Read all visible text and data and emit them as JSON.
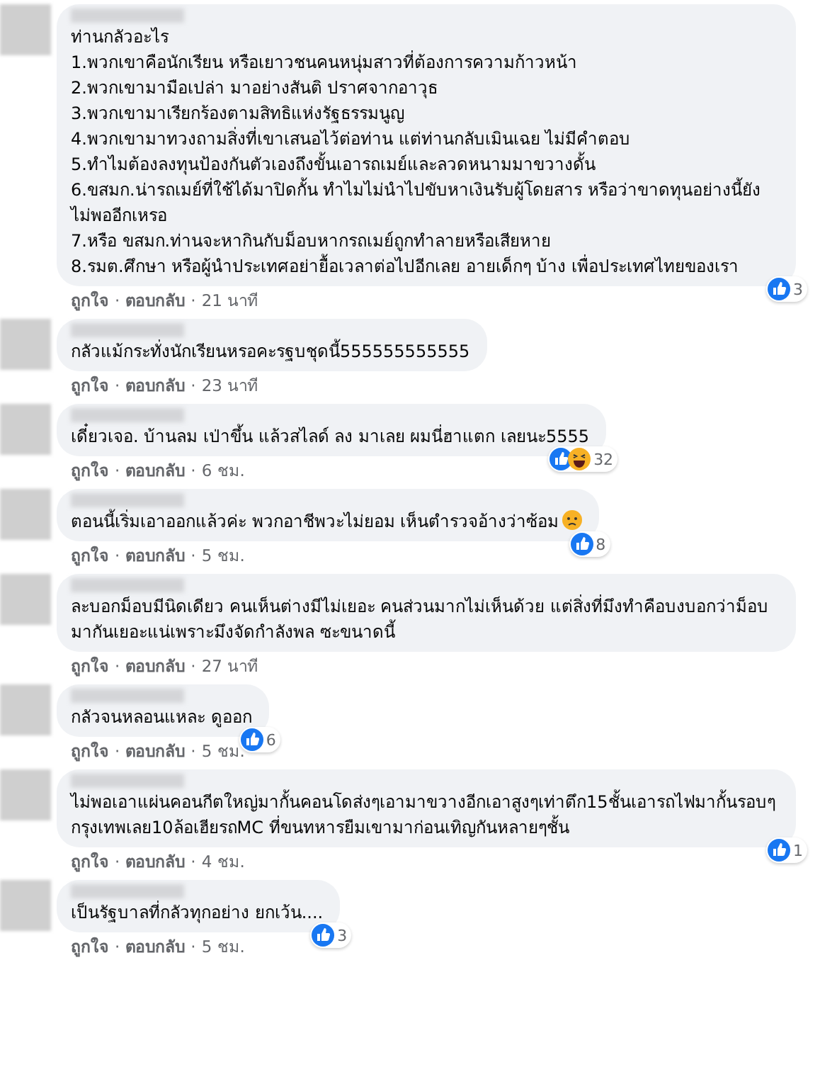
{
  "comments": [
    {
      "lines": [
        "ท่านกลัวอะไร",
        "1.พวกเขาคือนักเรียน หรือเยาวชนคนหนุ่มสาวที่ต้องการความก้าวหน้า",
        "2.พวกเขามามือเปล่า มาอย่างสันติ ปราศจากอาวุธ",
        "3.พวกเขามาเรียกร้องตามสิทธิแห่งรัฐธรรมนูญ",
        "4.พวกเขามาทวงถามสิ่งที่เขาเสนอไว้ต่อท่าน แต่ท่านกลับเมินเฉย ไม่มีคำตอบ",
        "5.ทำไมต้องลงทุนป้องกันตัวเองถึงขั้นเอารถเมย์และลวดหนามมาขวางดั้น",
        "6.ขสมก.น่ารถเมย์ที่ใช้ได้มาปิดกั้น ทำไมไม่นำไปขับหาเงินรับผู้โดยสาร หรือว่าขาดทุนอย่างนี้ยังไม่พออีกเหรอ",
        "7.หรือ ขสมก.ท่านจะหากินกับม็อบหากรถเมย์ถูกทำลายหรือเสียหาย",
        "8.รมต.ศึกษา หรือผู้นำประเทศอย่ายื้อเวลาต่อไปอีกเลย อายเด็กๆ บ้าง เพื่อประเทศไทยของเรา"
      ],
      "reactions": [
        {
          "kind": "like"
        }
      ],
      "count": "3",
      "meta": [
        {
          "kind": "link",
          "text": "ถูกใจ"
        },
        {
          "kind": "dot",
          "text": "·"
        },
        {
          "kind": "link",
          "text": "ตอบกลับ"
        },
        {
          "kind": "dot",
          "text": "·"
        },
        {
          "kind": "time",
          "text": "21 นาที"
        }
      ]
    },
    {
      "lines": [
        "กลัวแม้กระทั่งนักเรียนหรอคะรฐบชุดนี้555555555555"
      ],
      "meta": [
        {
          "kind": "link",
          "text": "ถูกใจ"
        },
        {
          "kind": "dot",
          "text": "·"
        },
        {
          "kind": "link",
          "text": "ตอบกลับ"
        },
        {
          "kind": "dot",
          "text": "·"
        },
        {
          "kind": "time",
          "text": "23 นาที"
        }
      ]
    },
    {
      "lines": [
        "เดี๋ยวเจอ. บ้านลม เป่าขึ้น แล้วสไลด์ ลง มาเลย ผมนี่ฮาแตก เลยนะ5555"
      ],
      "reactions": [
        {
          "kind": "like"
        },
        {
          "kind": "haha"
        }
      ],
      "count": "32",
      "meta": [
        {
          "kind": "link",
          "text": "ถูกใจ"
        },
        {
          "kind": "dot",
          "text": "·"
        },
        {
          "kind": "link",
          "text": "ตอบกลับ"
        },
        {
          "kind": "dot",
          "text": "·"
        },
        {
          "kind": "time",
          "text": "6 ชม."
        }
      ]
    },
    {
      "lines": [
        "ตอนนี้เริ่มเอาออกแล้วค่ะ พวกอาชีพวะไม่ยอม เห็นตำรวจอ้างว่าซ้อม"
      ],
      "emoji": true,
      "reactions": [
        {
          "kind": "like"
        }
      ],
      "count": "8",
      "meta": [
        {
          "kind": "link",
          "text": "ถูกใจ"
        },
        {
          "kind": "dot",
          "text": "·"
        },
        {
          "kind": "link",
          "text": "ตอบกลับ"
        },
        {
          "kind": "dot",
          "text": "·"
        },
        {
          "kind": "time",
          "text": "5 ชม."
        }
      ]
    },
    {
      "lines": [
        "ละบอกม็อบมีนิดเดียว คนเห็นต่างมีไม่เยอะ คนส่วนมากไม่เห็นด้วย แต่สิ่งที่มึงทำคือบงบอกว่าม็อบมากันเยอะแน่เพราะมึงจัดกำลังพล ซะขนาดนี้"
      ],
      "meta": [
        {
          "kind": "link",
          "text": "ถูกใจ"
        },
        {
          "kind": "dot",
          "text": "·"
        },
        {
          "kind": "link",
          "text": "ตอบกลับ"
        },
        {
          "kind": "dot",
          "text": "·"
        },
        {
          "kind": "time",
          "text": "27 นาที"
        }
      ]
    },
    {
      "lines": [
        "กลัวจนหลอนแหละ ดูออก"
      ],
      "reactions": [
        {
          "kind": "like"
        }
      ],
      "count": "6",
      "meta": [
        {
          "kind": "link",
          "text": "ถูกใจ"
        },
        {
          "kind": "dot",
          "text": "·"
        },
        {
          "kind": "link",
          "text": "ตอบกลับ"
        },
        {
          "kind": "dot",
          "text": "·"
        },
        {
          "kind": "time",
          "text": "5 ชม."
        }
      ]
    },
    {
      "lines": [
        "ไม่พอเอาแผ่นคอนกีตใหญ่มากั้นคอนโดส่งๆเอามาขวางอีกเอาสูงๆเท่าตึก15ชั้นเอารถไฟมากั้นรอบๆกรุงเทพเลย10ล้อเฮียรถMC ที่ขนทหารยืมเขามาก่อนเทิญกันหลายๆชั้น"
      ],
      "reactions": [
        {
          "kind": "like"
        }
      ],
      "count": "1",
      "meta": [
        {
          "kind": "link",
          "text": "ถูกใจ"
        },
        {
          "kind": "dot",
          "text": "·"
        },
        {
          "kind": "link",
          "text": "ตอบกลับ"
        },
        {
          "kind": "dot",
          "text": "·"
        },
        {
          "kind": "time",
          "text": "4 ชม."
        }
      ]
    },
    {
      "lines": [
        "เป็นรัฐบาลที่กลัวทุกอย่าง ยกเว้น...."
      ],
      "reactions": [
        {
          "kind": "like"
        }
      ],
      "count": "3",
      "meta": [
        {
          "kind": "link",
          "text": "ถูกใจ"
        },
        {
          "kind": "dot",
          "text": "·"
        },
        {
          "kind": "link",
          "text": "ตอบกลับ"
        },
        {
          "kind": "dot",
          "text": "·"
        },
        {
          "kind": "time",
          "text": "5 ชม."
        }
      ]
    }
  ]
}
